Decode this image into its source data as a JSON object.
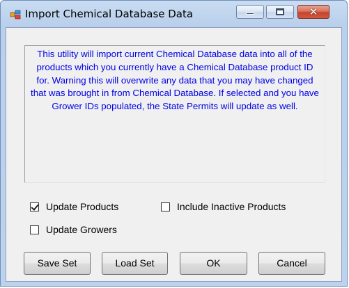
{
  "window": {
    "title": "Import Chemical Database Data",
    "controls": {
      "minimize": "minimize",
      "maximize": "maximize",
      "close": "✕"
    }
  },
  "info": {
    "message": "This utility will import current Chemical Database data into all of the products which you currently have a Chemical Database product ID for.  Warning this will overwrite any data that you may have changed that was brought in from Chemical Database.  If selected and you have Grower IDs populated, the State Permits will update as well."
  },
  "options": {
    "update_products": {
      "label": "Update Products",
      "checked": true
    },
    "include_inactive": {
      "label": "Include Inactive Products",
      "checked": false
    },
    "update_growers": {
      "label": "Update Growers",
      "checked": false
    }
  },
  "buttons": {
    "save_set": "Save Set",
    "load_set": "Load Set",
    "ok": "OK",
    "cancel": "Cancel"
  },
  "colors": {
    "info_text": "#0000e8",
    "close_button": "#c4442b",
    "titlebar": "#c9dcf2"
  }
}
